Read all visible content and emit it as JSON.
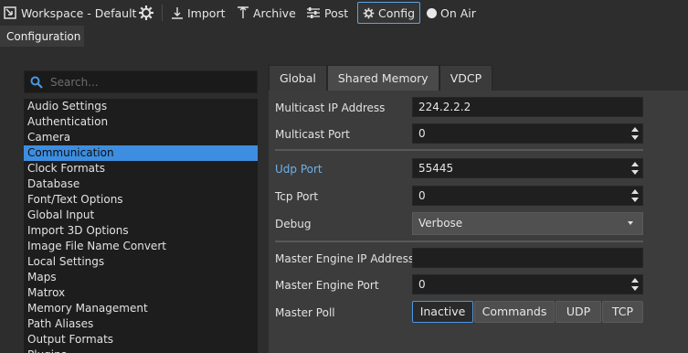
{
  "toolbar": {
    "workspace_label": "Workspace - Default",
    "import_label": "Import",
    "archive_label": "Archive",
    "post_label": "Post",
    "config_label": "Config",
    "onair_label": "On Air"
  },
  "config_tab": {
    "label": "Configuration"
  },
  "search": {
    "placeholder": "Search..."
  },
  "categories": [
    "Audio Settings",
    "Authentication",
    "Camera",
    "Communication",
    "Clock Formats",
    "Database",
    "Font/Text Options",
    "Global Input",
    "Import 3D Options",
    "Image File Name Convert",
    "Local Settings",
    "Maps",
    "Matrox",
    "Memory Management",
    "Path Aliases",
    "Output Formats",
    "Plugins"
  ],
  "selected_category": "Communication",
  "tabs": [
    "Global",
    "Shared Memory",
    "VDCP"
  ],
  "active_tab": "Shared Memory",
  "form": {
    "multicast_ip": {
      "label": "Multicast IP Address",
      "value": "224.2.2.2"
    },
    "multicast_port": {
      "label": "Multicast Port",
      "value": "0"
    },
    "udp_port": {
      "label": "Udp Port",
      "value": "55445"
    },
    "tcp_port": {
      "label": "Tcp Port",
      "value": "0"
    },
    "debug": {
      "label": "Debug",
      "value": "Verbose"
    },
    "master_ip": {
      "label": "Master Engine IP Address",
      "value": ""
    },
    "master_port": {
      "label": "Master Engine Port",
      "value": "0"
    },
    "master_poll": {
      "label": "Master Poll",
      "options": [
        "Inactive",
        "Commands",
        "UDP",
        "TCP"
      ],
      "selected": "Inactive"
    }
  },
  "colors": {
    "accent": "#3d8ee0",
    "label_accent": "#6fb1ea",
    "background": "#2d2d2d"
  }
}
